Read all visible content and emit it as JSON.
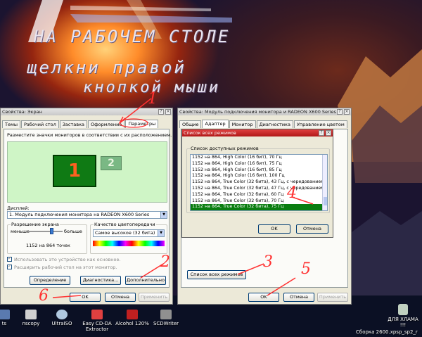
{
  "desktop": {
    "handwriting": {
      "line1": "НА РАБОЧЕМ СТОЛЕ",
      "line2": "щелкни правой",
      "line3": "кнопкой мыши"
    },
    "annotations": [
      "1",
      "2",
      "3",
      "4",
      "5",
      "6"
    ],
    "icons": [
      {
        "label": "ts"
      },
      {
        "label": "nscopy"
      },
      {
        "label": "UltraISO"
      },
      {
        "label": "Easy CD-DA Extractor"
      },
      {
        "label": "Alcohol 120%"
      },
      {
        "label": "SCDWriter"
      }
    ],
    "recycle_label": "ДЛЯ ХЛАМА !!!",
    "build_label": "Сборка 2600.xpsp_sp2_r"
  },
  "display_props": {
    "title": "Свойства: Экран",
    "tabs": [
      "Темы",
      "Рабочий стол",
      "Заставка",
      "Оформление",
      "Параметры"
    ],
    "active_tab": 4,
    "instruction": "Разместите значки мониторов в соответствии с их расположением.",
    "monitor1": "1",
    "monitor2": "2",
    "display_label": "Дисплей:",
    "display_value": "1. Модуль подключения монитора на RADEON X600 Series",
    "resolution": {
      "title": "Разрешение экрана",
      "less": "меньше",
      "more": "больше",
      "value": "1152 на 864 точек"
    },
    "color": {
      "title": "Качество цветопередачи",
      "value": "Самое высокое (32 бита)"
    },
    "check_primary": "Использовать это устройство как основное.",
    "check_extend": "Расширить рабочий стол на этот монитор.",
    "btn_identify": "Определение",
    "btn_diagnostics": "Диагностика...",
    "btn_advanced": "Дополнительно",
    "btn_ok": "OK",
    "btn_cancel": "Отмена",
    "btn_apply": "Применить"
  },
  "adapter_props": {
    "title": "Свойства: Модуль подключения монитора и RADEON X600 Series",
    "tabs": [
      "Общие",
      "Адаптер",
      "Монитор",
      "Диагностика",
      "Управление цветом"
    ],
    "active_tab": 1,
    "btn_list_modes": "Список всех режимов",
    "btn_ok": "OK",
    "btn_cancel": "Отмена",
    "btn_apply": "Применить"
  },
  "modes_dialog": {
    "title": "Список всех режимов",
    "group_title": "Список доступных режимов",
    "modes": [
      "1152 на 864, High Color (16 бит), 70 Гц",
      "1152 на 864, High Color (16 бит), 75 Гц",
      "1152 на 864, High Color (16 бит), 85 Гц",
      "1152 на 864, High Color (16 бит), 100 Гц",
      "1152 на 864, True Color (32 бита), 43 Гц, с чередованием",
      "1152 на 864, True Color (32 бита), 47 Гц, с чередованием",
      "1152 на 864, True Color (32 бита), 60 Гц",
      "1152 на 864, True Color (32 бита), 70 Гц",
      "1152 на 864, True Color (32 бита), 75 Гц"
    ],
    "selected_index": 8,
    "btn_ok": "OK",
    "btn_cancel": "Отмена"
  },
  "colors": {
    "selection": "#0a7d10",
    "annotation": "#ff3030",
    "monitor_fill": "#0f7a14"
  }
}
